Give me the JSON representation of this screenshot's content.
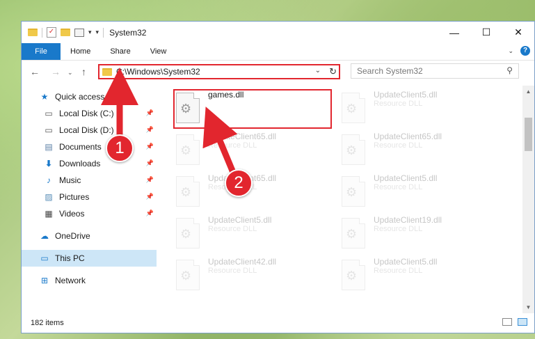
{
  "window": {
    "title": "System32",
    "controls": {
      "minimize": "—",
      "maximize": "☐",
      "close": "✕"
    }
  },
  "ribbon": {
    "file_tab": "File",
    "tabs": [
      "Home",
      "Share",
      "View"
    ]
  },
  "navigation": {
    "address": "C:\\Windows\\System32",
    "search_placeholder": "Search System32"
  },
  "sidebar": {
    "items": [
      {
        "label": "Quick access",
        "icon": "star-icon"
      },
      {
        "label": "Local Disk (C:)",
        "icon": "drive-icon",
        "pinned": true
      },
      {
        "label": "Local Disk (D:)",
        "icon": "drive-icon",
        "pinned": true
      },
      {
        "label": "Documents",
        "icon": "documents-icon",
        "pinned": true
      },
      {
        "label": "Downloads",
        "icon": "download-icon",
        "pinned": true
      },
      {
        "label": "Music",
        "icon": "music-icon",
        "pinned": true
      },
      {
        "label": "Pictures",
        "icon": "pictures-icon",
        "pinned": true
      },
      {
        "label": "Videos",
        "icon": "videos-icon",
        "pinned": true
      },
      {
        "label": "OneDrive",
        "icon": "cloud-icon"
      },
      {
        "label": "This PC",
        "icon": "computer-icon",
        "selected": true
      },
      {
        "label": "Network",
        "icon": "network-icon"
      }
    ]
  },
  "files": [
    {
      "name": "games.dll",
      "type": ""
    },
    {
      "name": "UpdateClient5.dll",
      "type": "Resource DLL"
    },
    {
      "name": "UpdateClient65.dll",
      "type": "Resource DLL"
    },
    {
      "name": "UpdateClient65.dll",
      "type": "Resource DLL"
    },
    {
      "name": "UpdateClient65.dll",
      "type": "Resource DLL"
    },
    {
      "name": "UpdateClient5.dll",
      "type": "Resource DLL"
    },
    {
      "name": "UpdateClient5.dll",
      "type": "Resource DLL"
    },
    {
      "name": "UpdateClient19.dll",
      "type": "Resource DLL"
    },
    {
      "name": "UpdateClient42.dll",
      "type": "Resource DLL"
    },
    {
      "name": "UpdateClient5.dll",
      "type": "Resource DLL"
    }
  ],
  "status": {
    "item_count": "182 items"
  },
  "annotations": {
    "marker_1": "1",
    "marker_2": "2"
  },
  "colors": {
    "accent": "#1979ca",
    "highlight": "#e2262e",
    "selected": "#cde6f7"
  }
}
